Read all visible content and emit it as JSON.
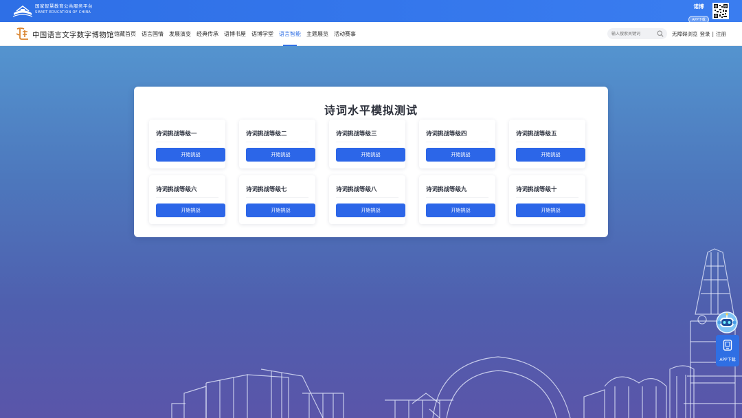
{
  "topbar": {
    "platform_cn": "国家智慧教育公共服务平台",
    "platform_en": "SMART EDUCATION OF CHINA",
    "user_name": "诺博",
    "app_badge": "APP下载"
  },
  "navbar": {
    "brand": "中国语言文字数字博物馆",
    "items": [
      {
        "label": "馆藏首页"
      },
      {
        "label": "语言国情"
      },
      {
        "label": "发展演变"
      },
      {
        "label": "经典传承"
      },
      {
        "label": "语博书屋"
      },
      {
        "label": "语博学堂"
      },
      {
        "label": "语言智能"
      },
      {
        "label": "主题展览"
      },
      {
        "label": "活动赛事"
      }
    ],
    "active_index": 6,
    "search_placeholder": "输入搜索关键词",
    "accessibility": "无障碍浏览",
    "login": "登录",
    "divider": "|",
    "register": "注册"
  },
  "card": {
    "title": "诗词水平模拟测试",
    "levels": [
      {
        "label": "诗词挑战等级一",
        "button": "开始挑战"
      },
      {
        "label": "诗词挑战等级二",
        "button": "开始挑战"
      },
      {
        "label": "诗词挑战等级三",
        "button": "开始挑战"
      },
      {
        "label": "诗词挑战等级四",
        "button": "开始挑战"
      },
      {
        "label": "诗词挑战等级五",
        "button": "开始挑战"
      },
      {
        "label": "诗词挑战等级六",
        "button": "开始挑战"
      },
      {
        "label": "诗词挑战等级七",
        "button": "开始挑战"
      },
      {
        "label": "诗词挑战等级八",
        "button": "开始挑战"
      },
      {
        "label": "诗词挑战等级九",
        "button": "开始挑战"
      },
      {
        "label": "诗词挑战等级十",
        "button": "开始挑战"
      }
    ]
  },
  "float": {
    "app_label": "APP下载"
  },
  "colors": {
    "topbar": "#2e6fe6",
    "accent": "#2f6fe4",
    "button": "#2c66e8"
  }
}
